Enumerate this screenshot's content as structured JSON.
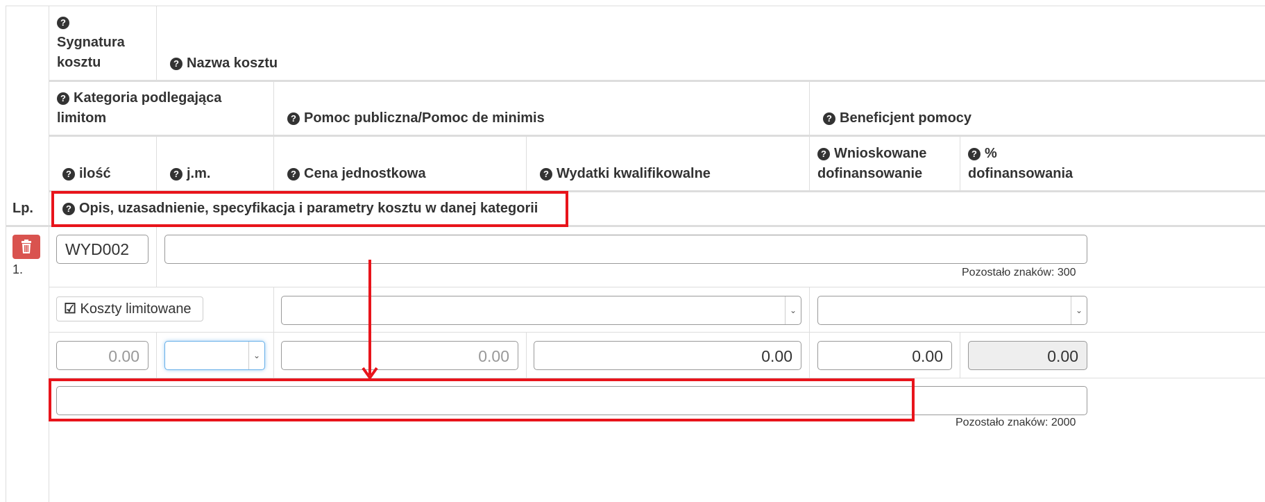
{
  "headers": {
    "sygnatura": "Sygnatura kosztu",
    "nazwa": "Nazwa kosztu",
    "kategoria": "Kategoria podlegająca limitom",
    "pomoc": "Pomoc publiczna/Pomoc de minimis",
    "beneficjent": "Beneficjent pomocy",
    "ilosc": "ilość",
    "jm": "j.m.",
    "cena": "Cena jednostkowa",
    "wydatki": "Wydatki kwalifikowalne",
    "wnioskowane": "Wnioskowane dofinansowanie",
    "procent": "% dofinansowania",
    "lp": "Lp.",
    "opis": "Opis, uzasadnienie, specyfikacja i parametry kosztu w danej kategorii"
  },
  "row": {
    "number": "1.",
    "sygnatura_value": "WYD002",
    "nazwa_value": "",
    "nazwa_remaining": "Pozostało znaków: 300",
    "limit_button": "Koszty limitowane",
    "pomoc_value": "",
    "beneficjent_value": "",
    "ilosc_value": "0.00",
    "jm_value": "",
    "cena_value": "0.00",
    "wydatki_value": "0.00",
    "wnioskowane_value": "0.00",
    "procent_value": "0.00",
    "opis_value": "",
    "opis_remaining": "Pozostało znaków: 2000"
  },
  "icons": {
    "help": "question-circle-icon",
    "delete": "trash-icon",
    "checkbox": "check-square-icon",
    "select": "chevron-down-icon"
  },
  "colors": {
    "highlight": "#e8141b",
    "delete_button": "#d9534f",
    "readonly_bg": "#eeeeee"
  }
}
